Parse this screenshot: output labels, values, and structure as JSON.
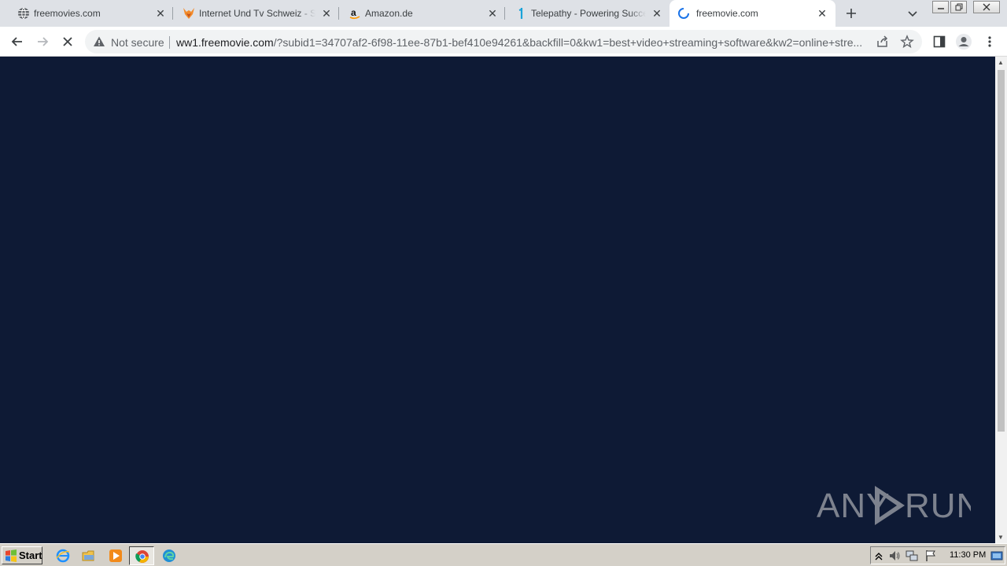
{
  "tabs": [
    {
      "title": "freemovies.com",
      "icon": "globe-icon",
      "active": false
    },
    {
      "title": "Internet Und Tv Schweiz - SlyTrend",
      "icon": "fox-icon",
      "active": false
    },
    {
      "title": "Amazon.de",
      "icon": "amazon-icon",
      "active": false
    },
    {
      "title": "Telepathy - Powering Successful",
      "icon": "telepathy-icon",
      "active": false
    },
    {
      "title": "freemovie.com",
      "icon": "loading-spinner-icon",
      "active": true
    }
  ],
  "omnibox": {
    "security_label": "Not secure",
    "url_host": "ww1.freemovie.com",
    "url_rest": "/?subid1=34707af2-6f98-11ee-87b1-bef410e94261&backfill=0&kw1=best+video+streaming+software&kw2=online+stre..."
  },
  "watermark": {
    "text_left": "ANY",
    "text_right": "RUN"
  },
  "taskbar": {
    "start_label": "Start",
    "clock": "11:30 PM"
  },
  "colors": {
    "page_background": "#0e1a35",
    "tabstrip": "#dee1e6",
    "taskbar": "#d4d0c8"
  }
}
